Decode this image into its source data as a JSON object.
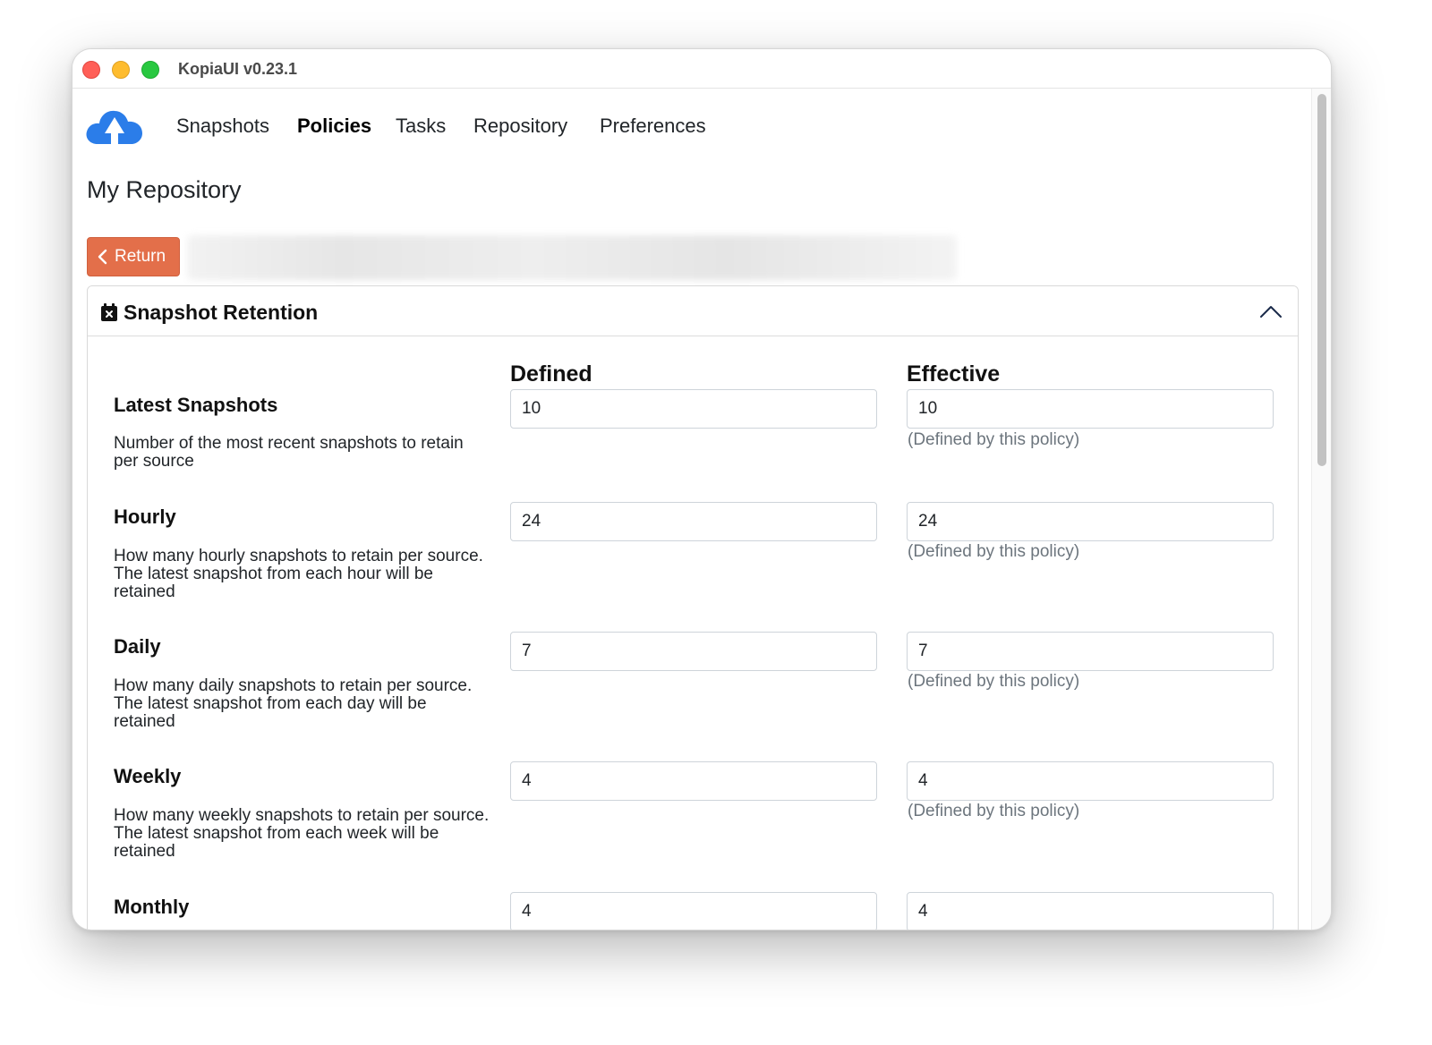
{
  "window": {
    "title": "KopiaUI v0.23.1"
  },
  "nav": {
    "items": [
      {
        "label": "Snapshots"
      },
      {
        "label": "Policies"
      },
      {
        "label": "Tasks"
      },
      {
        "label": "Repository"
      },
      {
        "label": "Preferences"
      }
    ],
    "active": "Policies"
  },
  "page": {
    "title": "My Repository",
    "return_label": "Return"
  },
  "section": {
    "title": "Snapshot Retention",
    "defined_header": "Defined",
    "effective_header": "Effective",
    "rows": [
      {
        "label": "Latest Snapshots",
        "description": "Number of the most recent snapshots to retain per source",
        "defined": "10",
        "effective": "10",
        "hint": "(Defined by this policy)"
      },
      {
        "label": "Hourly",
        "description": "How many hourly snapshots to retain per source. The latest snapshot from each hour will be retained",
        "defined": "24",
        "effective": "24",
        "hint": "(Defined by this policy)"
      },
      {
        "label": "Daily",
        "description": "How many daily snapshots to retain per source. The latest snapshot from each day will be retained",
        "defined": "7",
        "effective": "7",
        "hint": "(Defined by this policy)"
      },
      {
        "label": "Weekly",
        "description": "How many weekly snapshots to retain per source. The latest snapshot from each week will be retained",
        "defined": "4",
        "effective": "4",
        "hint": "(Defined by this policy)"
      },
      {
        "label": "Monthly",
        "description": "",
        "defined": "4",
        "effective": "4",
        "hint": ""
      }
    ]
  },
  "colors": {
    "accent": "#e36f4a",
    "logo": "#2b7de9",
    "hint_text": "#6c757d"
  }
}
